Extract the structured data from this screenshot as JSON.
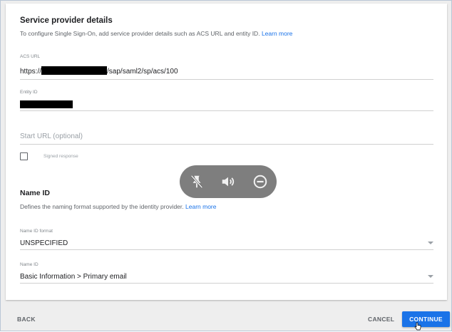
{
  "sp_section": {
    "title": "Service provider details",
    "description": "To configure Single Sign-On, add service provider details such as ACS URL and entity ID.",
    "learn_more": "Learn more"
  },
  "acs_url": {
    "label": "ACS URL",
    "prefix": "https://",
    "suffix": "/sap/saml2/sp/acs/100"
  },
  "entity_id": {
    "label": "Entity ID"
  },
  "start_url": {
    "placeholder": "Start URL (optional)"
  },
  "signed_response": {
    "label": "Signed response",
    "checked": false
  },
  "overlay": {
    "icons": [
      "unpin-icon",
      "volume-icon",
      "minus-circle-icon"
    ]
  },
  "name_id_section": {
    "title": "Name ID",
    "description": "Defines the naming format supported by the identity provider.",
    "learn_more": "Learn more"
  },
  "name_id_format": {
    "label": "Name ID format",
    "value": "UNSPECIFIED"
  },
  "name_id": {
    "label": "Name ID",
    "value": "Basic Information > Primary email"
  },
  "footer": {
    "back": "BACK",
    "cancel": "CANCEL",
    "continue": "CONTINUE"
  },
  "colors": {
    "accent": "#1a73e8",
    "background": "#eeeeee",
    "card": "#ffffff"
  }
}
